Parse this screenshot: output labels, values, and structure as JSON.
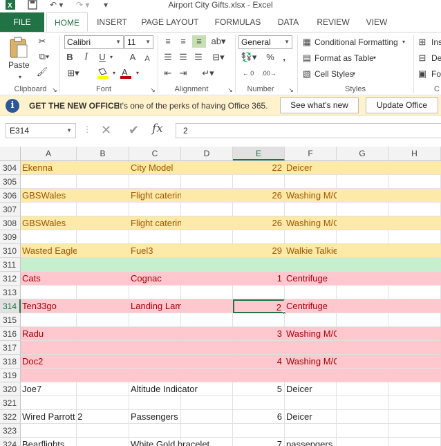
{
  "titlebar": {
    "title": "Airport City Gifts.xlsx - Excel",
    "qat": [
      "💾",
      "↶",
      "↷",
      "▾"
    ]
  },
  "tabs": [
    "FILE",
    "HOME",
    "INSERT",
    "PAGE LAYOUT",
    "FORMULAS",
    "DATA",
    "REVIEW",
    "VIEW"
  ],
  "ribbon": {
    "clipboard": {
      "paste_label": "Paste",
      "group_label": "Clipboard"
    },
    "font": {
      "name": "Calibri",
      "size": "11",
      "group_label": "Font",
      "bold": "B",
      "italic": "I",
      "underline": "U",
      "grow": "A",
      "shrink": "A"
    },
    "alignment": {
      "group_label": "Alignment"
    },
    "number": {
      "format": "General",
      "group_label": "Number",
      "percent": "%",
      "comma": ","
    },
    "styles": {
      "conditional": "Conditional Formatting",
      "format_table": "Format as Table",
      "cell_styles": "Cell Styles",
      "group_label": "Styles"
    },
    "cells": {
      "insert": "Ins",
      "delete": "De",
      "format": "Fo",
      "group_label": "C"
    }
  },
  "message_bar": {
    "title": "GET THE NEW OFFICE",
    "text": "It's one of the perks of having Office 365.",
    "see_whats_new": "See what's new",
    "update_office": "Update Office"
  },
  "formula_bar": {
    "name_box": "E314",
    "formula": "2",
    "fx": "fx"
  },
  "columns": [
    "A",
    "B",
    "C",
    "D",
    "E",
    "F",
    "G",
    "H"
  ],
  "selected_column": "E",
  "rows": [
    {
      "num": "304",
      "style": "yellow",
      "a": "Ekenna",
      "c": "City Model",
      "e": "22",
      "f": "Deicer"
    },
    {
      "num": "305",
      "style": "",
      "a": "",
      "c": "",
      "e": "",
      "f": ""
    },
    {
      "num": "306",
      "style": "yellow",
      "a": "GBSWales",
      "c": "Flight catering",
      "e": "26",
      "f": "Washing M/C"
    },
    {
      "num": "307",
      "style": "",
      "a": "",
      "c": "",
      "e": "",
      "f": ""
    },
    {
      "num": "308",
      "style": "yellow",
      "a": "GBSWales",
      "c": "Flight catering",
      "e": "26",
      "f": "Washing M/C"
    },
    {
      "num": "309",
      "style": "",
      "a": "",
      "c": "",
      "e": "",
      "f": ""
    },
    {
      "num": "310",
      "style": "yellow",
      "a": "Wasted Eagle",
      "c": "Fuel3",
      "e": "29",
      "f": "Walkie Talkie"
    },
    {
      "num": "311",
      "style": "green",
      "a": "",
      "c": "",
      "e": "",
      "f": ""
    },
    {
      "num": "312",
      "style": "red",
      "a": "Cats",
      "c": "Cognac",
      "e": "1",
      "f": "Centrifuge"
    },
    {
      "num": "313",
      "style": "",
      "a": "",
      "c": "",
      "e": "",
      "f": ""
    },
    {
      "num": "314",
      "style": "red",
      "a": "Ten33go",
      "c": "Landing Lamp",
      "e": "2",
      "f": "Centrifuge"
    },
    {
      "num": "315",
      "style": "",
      "a": "",
      "c": "",
      "e": "",
      "f": ""
    },
    {
      "num": "316",
      "style": "red",
      "a": "Radu",
      "c": "",
      "e": "3",
      "f": "Washing M/C"
    },
    {
      "num": "317",
      "style": "red",
      "a": "",
      "c": "",
      "e": "",
      "f": ""
    },
    {
      "num": "318",
      "style": "red",
      "a": "Doc2",
      "c": "",
      "e": "4",
      "f": "Washing M/C"
    },
    {
      "num": "319",
      "style": "red",
      "a": "",
      "c": "",
      "e": "",
      "f": ""
    },
    {
      "num": "320",
      "style": "",
      "a": "Joe7",
      "c": "Altitude Indicator",
      "e": "5",
      "f": "Deicer"
    },
    {
      "num": "321",
      "style": "",
      "a": "",
      "c": "",
      "e": "",
      "f": ""
    },
    {
      "num": "322",
      "style": "",
      "a": "Wired Parrott 2",
      "c": "Passengers",
      "e": "6",
      "f": "Deicer"
    },
    {
      "num": "323",
      "style": "",
      "a": "",
      "c": "",
      "e": "",
      "f": ""
    },
    {
      "num": "324",
      "style": "",
      "a": "Bearflights",
      "c": "White Gold bracelet",
      "e": "7",
      "f": "passengers"
    }
  ],
  "active_row": "314",
  "colors": {
    "excel_green": "#217346",
    "yellow_fill": "#fde9a8",
    "green_fill": "#c6efce",
    "red_fill": "#ffc7ce"
  }
}
